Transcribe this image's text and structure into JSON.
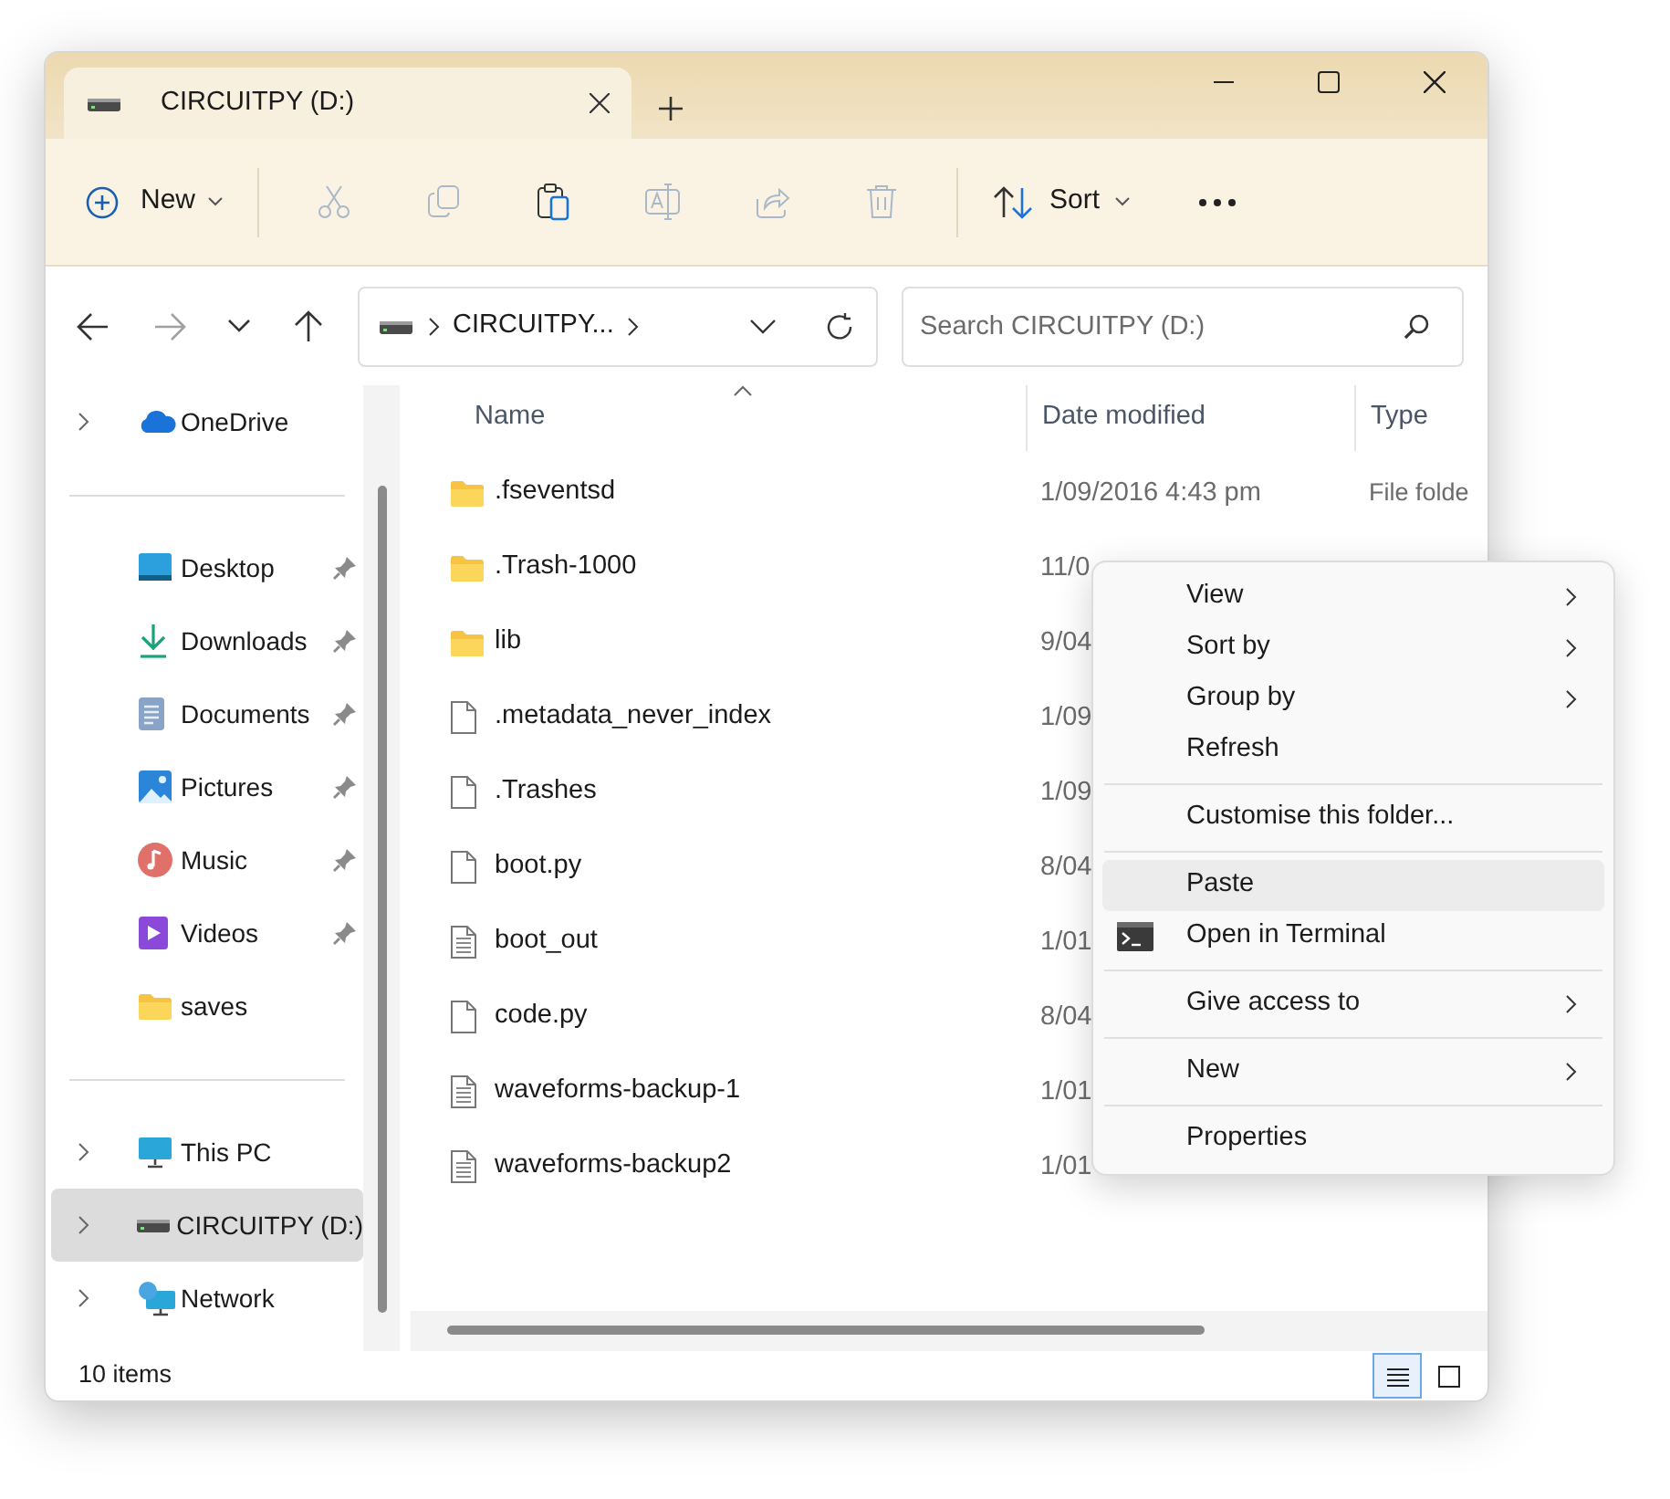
{
  "tab": {
    "title": "CIRCUITPY (D:)",
    "selected": true
  },
  "toolbar": {
    "new": {
      "label": "New"
    },
    "actions": [
      {
        "kind": "cut",
        "disabled": true
      },
      {
        "kind": "copy",
        "disabled": true
      },
      {
        "kind": "paste",
        "disabled": false
      },
      {
        "kind": "rename",
        "disabled": true
      },
      {
        "kind": "share",
        "disabled": true
      },
      {
        "kind": "delete",
        "disabled": true
      }
    ],
    "sort": {
      "label": "Sort"
    }
  },
  "nav": {
    "back_disabled": false,
    "forward_disabled": true
  },
  "address": {
    "crumbs": [
      "CIRCUITPY..."
    ]
  },
  "search": {
    "placeholder": "Search CIRCUITPY (D:)"
  },
  "sidebar": {
    "sections": [
      [
        {
          "label": "OneDrive",
          "kind": "onedrive",
          "expandable": true,
          "pinned": false,
          "selected": false
        }
      ],
      [
        {
          "label": "Desktop",
          "kind": "desktop",
          "expandable": false,
          "pinned": true,
          "selected": false
        },
        {
          "label": "Downloads",
          "kind": "downloads",
          "expandable": false,
          "pinned": true,
          "selected": false
        },
        {
          "label": "Documents",
          "kind": "documents",
          "expandable": false,
          "pinned": true,
          "selected": false
        },
        {
          "label": "Pictures",
          "kind": "pictures",
          "expandable": false,
          "pinned": true,
          "selected": false
        },
        {
          "label": "Music",
          "kind": "music",
          "expandable": false,
          "pinned": true,
          "selected": false
        },
        {
          "label": "Videos",
          "kind": "videos",
          "expandable": false,
          "pinned": true,
          "selected": false
        },
        {
          "label": "saves",
          "kind": "folder",
          "expandable": false,
          "pinned": false,
          "selected": false
        }
      ],
      [
        {
          "label": "This PC",
          "kind": "pc",
          "expandable": true,
          "pinned": false,
          "selected": false
        },
        {
          "label": "CIRCUITPY (D:)",
          "kind": "drive",
          "expandable": true,
          "pinned": false,
          "selected": true
        },
        {
          "label": "Network",
          "kind": "network",
          "expandable": true,
          "pinned": false,
          "selected": false
        }
      ]
    ]
  },
  "table": {
    "columns": [
      {
        "label": "Name",
        "sorted": true
      },
      {
        "label": "Date modified",
        "sorted": false
      },
      {
        "label": "Type",
        "sorted": false
      }
    ],
    "rows": [
      {
        "name": ".fseventsd",
        "kind": "folder",
        "date": "1/09/2016 4:43 pm",
        "type": "File folde"
      },
      {
        "name": ".Trash-1000",
        "kind": "folder",
        "date": "11/0"
      },
      {
        "name": "lib",
        "kind": "folder",
        "date": "9/04"
      },
      {
        "name": ".metadata_never_index",
        "kind": "file",
        "date": "1/09"
      },
      {
        "name": ".Trashes",
        "kind": "file",
        "date": "1/09"
      },
      {
        "name": "boot.py",
        "kind": "file",
        "date": "8/04"
      },
      {
        "name": "boot_out",
        "kind": "text",
        "date": "1/01"
      },
      {
        "name": "code.py",
        "kind": "file",
        "date": "8/04"
      },
      {
        "name": "waveforms-backup-1",
        "kind": "text",
        "date": "1/01"
      },
      {
        "name": "waveforms-backup2",
        "kind": "text",
        "date": "1/01"
      }
    ]
  },
  "status_bar": {
    "count": "10 items",
    "views": [
      {
        "kind": "details",
        "selected": true
      },
      {
        "kind": "tiles",
        "selected": false
      }
    ]
  },
  "context_menu": {
    "items": [
      {
        "kind": "item",
        "label": "View",
        "submenu": true,
        "selected": false,
        "terminal_icon": false
      },
      {
        "kind": "item",
        "label": "Sort by",
        "submenu": true,
        "selected": false,
        "terminal_icon": false
      },
      {
        "kind": "item",
        "label": "Group by",
        "submenu": true,
        "selected": false,
        "terminal_icon": false
      },
      {
        "kind": "item",
        "label": "Refresh",
        "submenu": false,
        "selected": false,
        "terminal_icon": false
      },
      {
        "kind": "separator"
      },
      {
        "kind": "item",
        "label": "Customise this folder...",
        "submenu": false,
        "selected": false,
        "terminal_icon": false
      },
      {
        "kind": "separator"
      },
      {
        "kind": "item",
        "label": "Paste",
        "submenu": false,
        "selected": true,
        "terminal_icon": false
      },
      {
        "kind": "item",
        "label": "Open in Terminal",
        "submenu": false,
        "selected": false,
        "terminal_icon": true
      },
      {
        "kind": "separator"
      },
      {
        "kind": "item",
        "label": "Give access to",
        "submenu": true,
        "selected": false,
        "terminal_icon": false
      },
      {
        "kind": "separator"
      },
      {
        "kind": "item",
        "label": "New",
        "submenu": true,
        "selected": false,
        "terminal_icon": false
      },
      {
        "kind": "separator"
      },
      {
        "kind": "item",
        "label": "Properties",
        "submenu": false,
        "selected": false,
        "terminal_icon": false
      }
    ]
  }
}
